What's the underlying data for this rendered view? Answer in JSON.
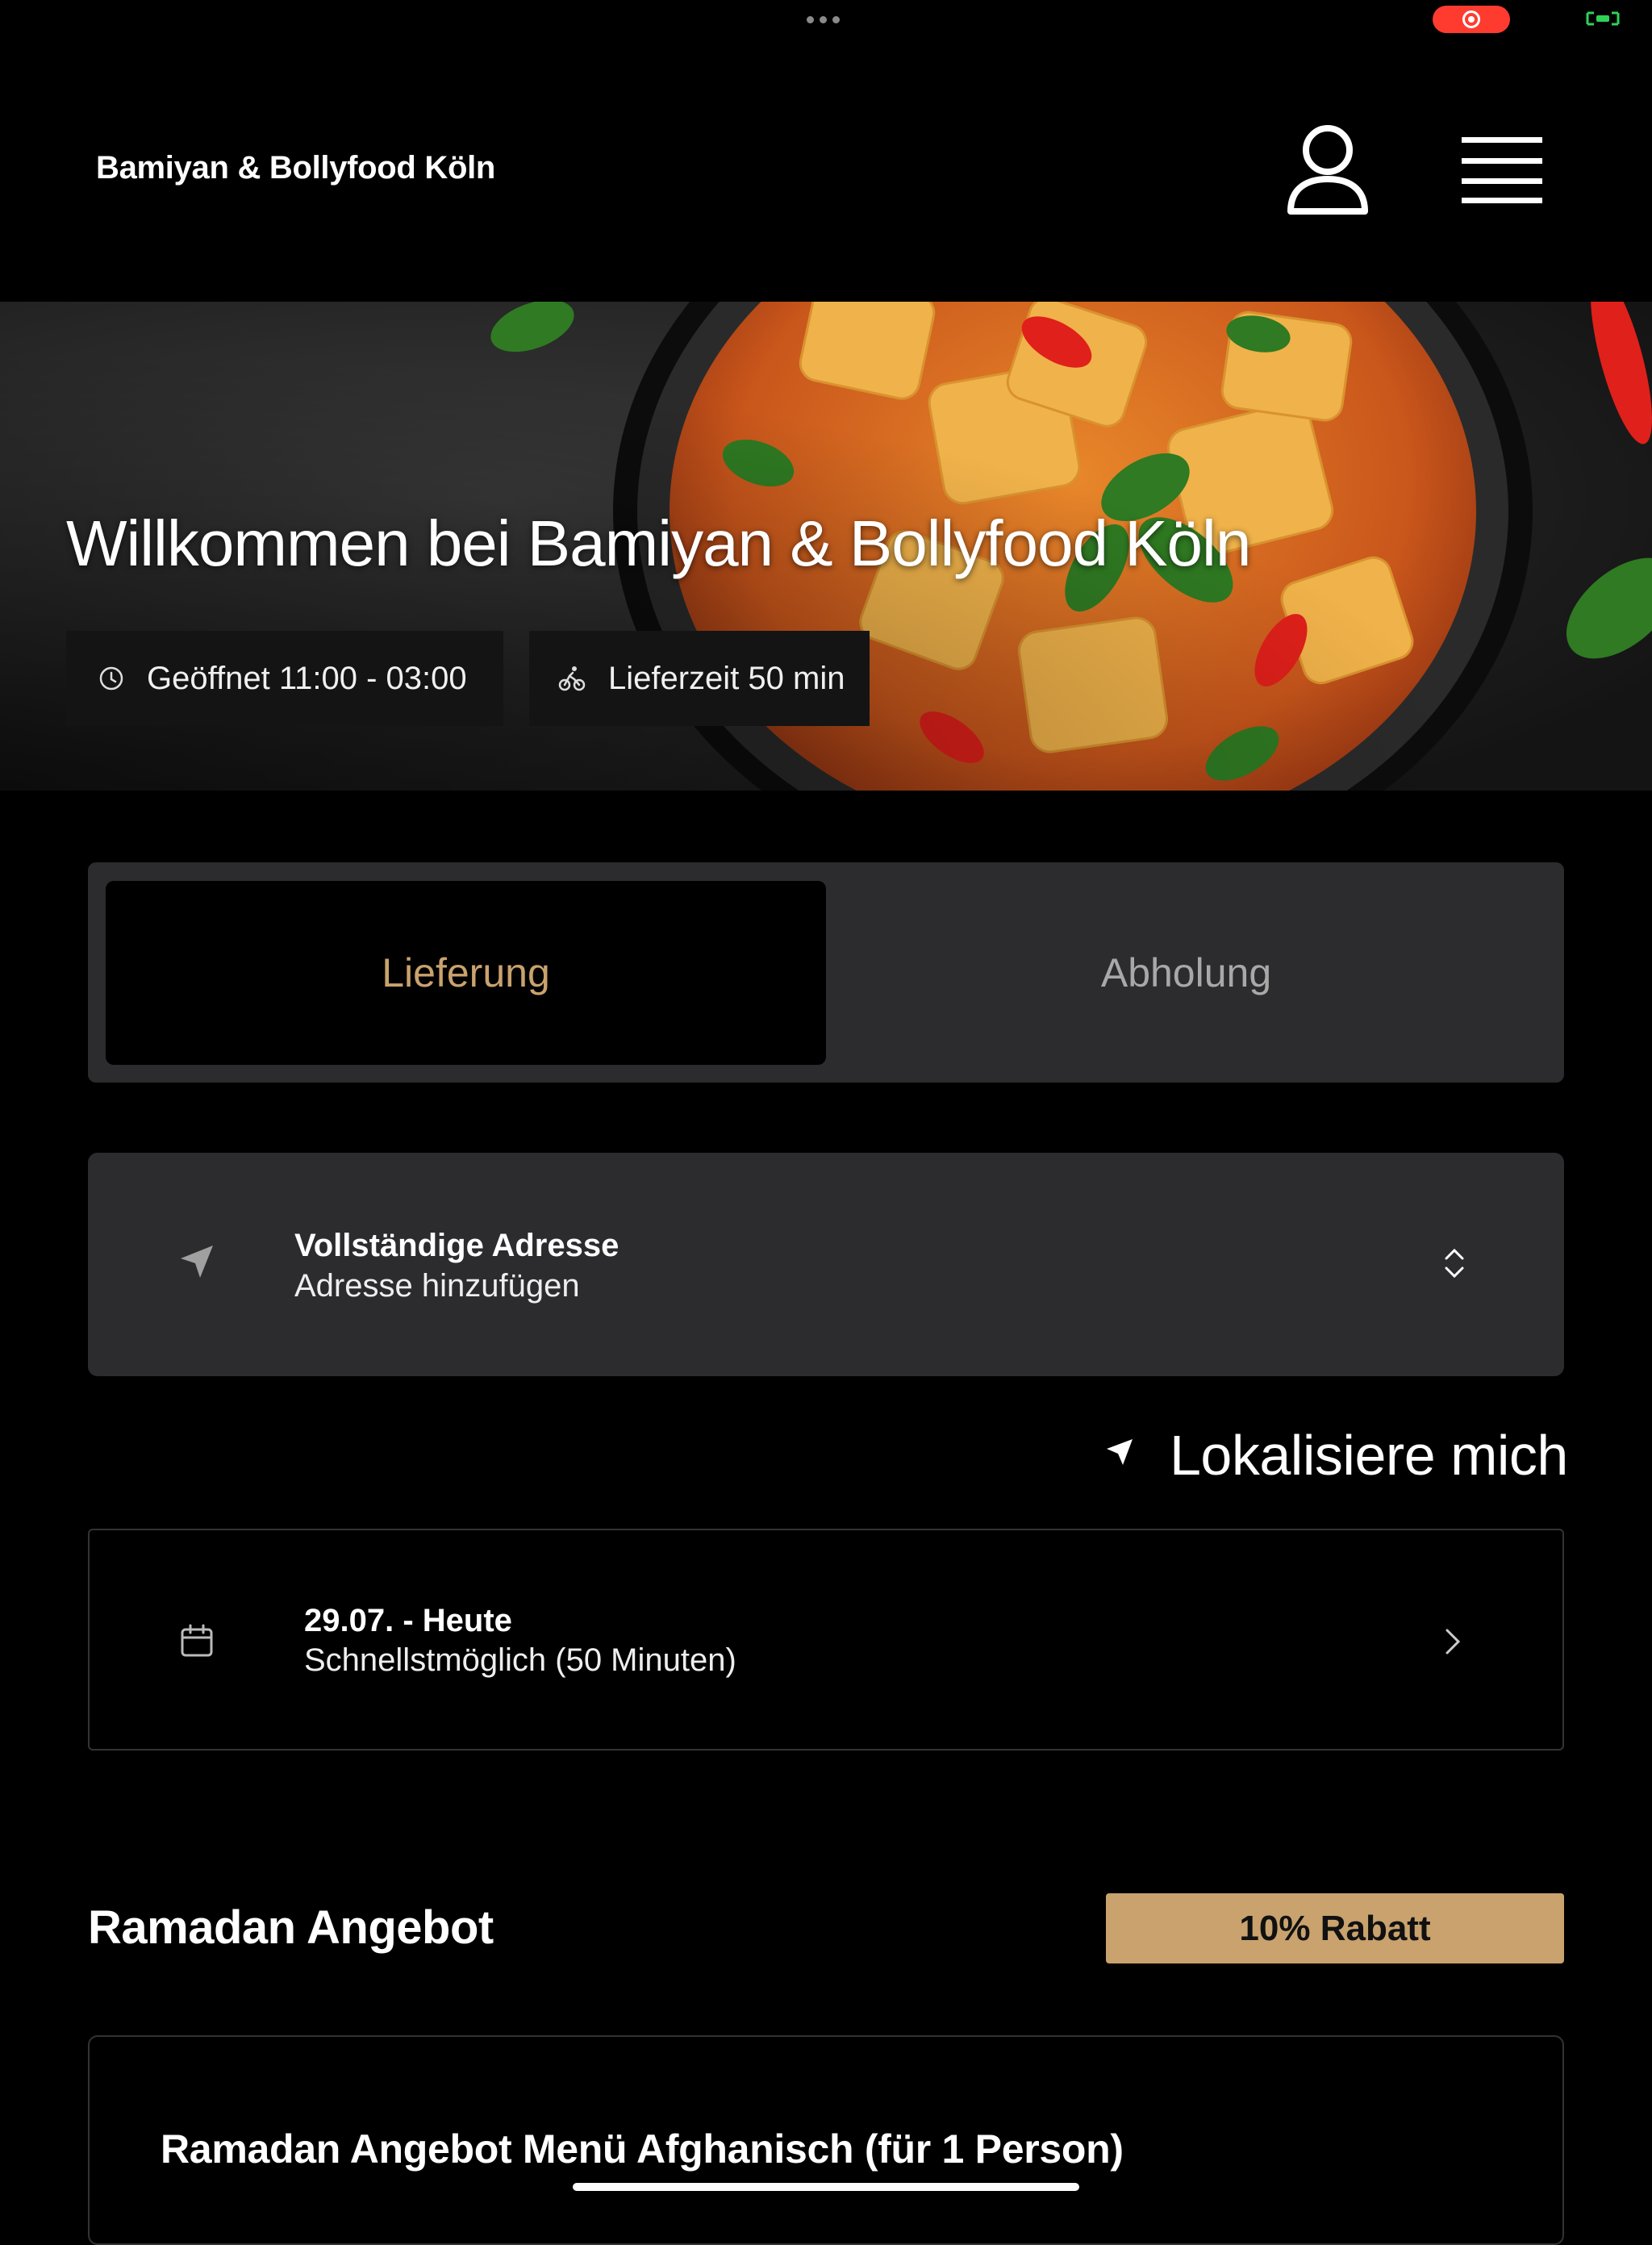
{
  "header": {
    "brand": "Bamiyan & Bollyfood Köln",
    "user_icon": "user-icon",
    "menu_icon": "hamburger-menu-icon"
  },
  "hero": {
    "title": "Willkommen bei Bamiyan & Bollyfood Köln",
    "opening_hours": "Geöffnet 11:00 - 03:00",
    "delivery_time": "Lieferzeit 50 min",
    "opening_icon": "clock-icon",
    "delivery_icon": "bicycle-courier-icon"
  },
  "order_mode": {
    "options": [
      "Lieferung",
      "Abholung"
    ],
    "selected": "Lieferung"
  },
  "address": {
    "title": "Vollständige Adresse",
    "placeholder": "Adresse hinzufügen",
    "icon": "location-arrow-icon"
  },
  "locate": {
    "label": "Lokalisiere mich"
  },
  "schedule": {
    "date": "29.07. - Heute",
    "time": "Schnellstmöglich (50 Minuten)",
    "icon": "calendar-icon"
  },
  "promo": {
    "title": "Ramadan Angebot",
    "badge": "10% Rabatt",
    "first_item": "Ramadan Angebot Menü Afghanisch (für 1 Person)"
  },
  "colors": {
    "accent": "#c9a26d",
    "background": "#000000",
    "surface": "#2c2c2e",
    "record_indicator": "#ff3b30"
  }
}
